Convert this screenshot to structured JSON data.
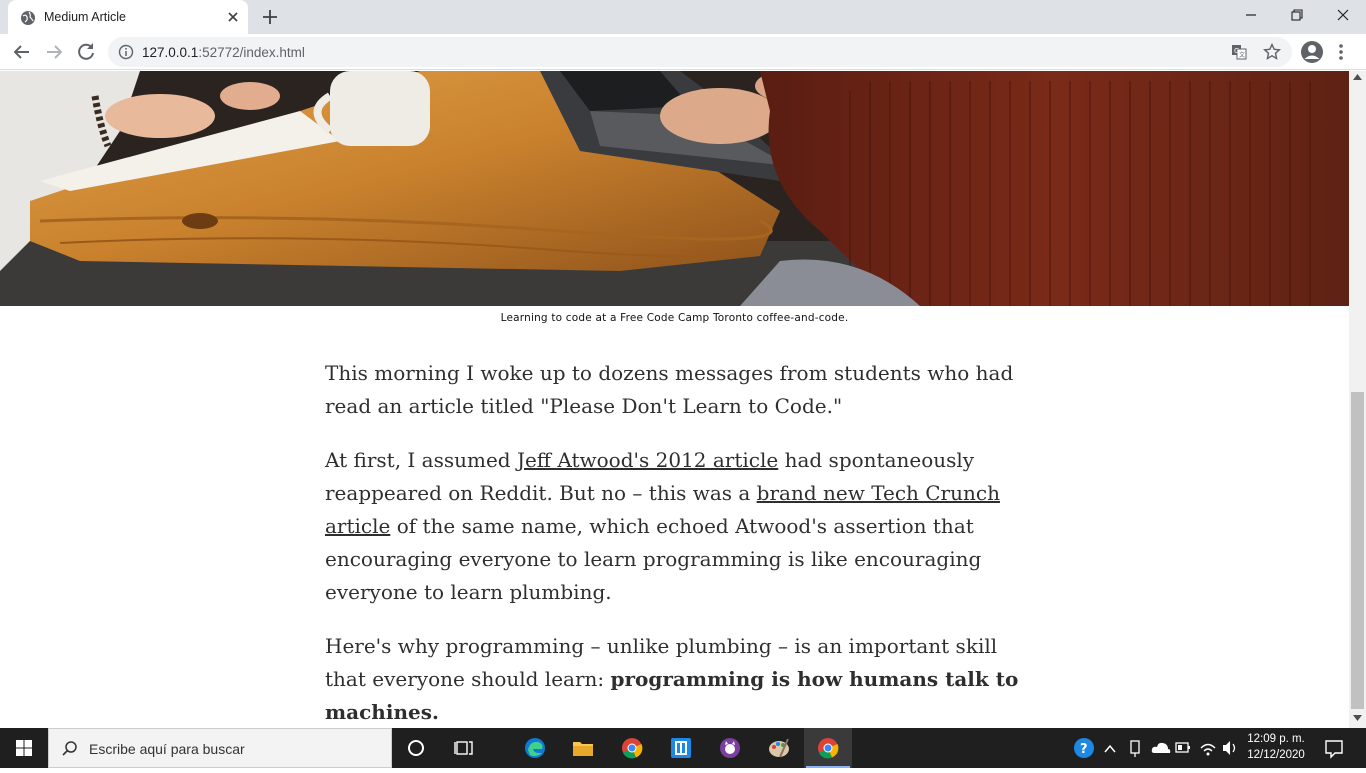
{
  "browser": {
    "tab_title": "Medium Article",
    "url_host": "127.0.0.1",
    "url_path": ":52772/index.html"
  },
  "article": {
    "caption": "Learning to code at a Free Code Camp Toronto coffee-and-code.",
    "p1": "This morning I woke up to dozens messages from students who had read an article titled \"Please Don't Learn to Code.\"",
    "p2_a": "At first, I assumed ",
    "p2_link1": "Jeff Atwood's 2012 article",
    "p2_b": " had spontaneously reappeared on Reddit. But no – this was a ",
    "p2_link2": "brand new Tech Crunch article",
    "p2_c": " of the same name, which echoed Atwood's assertion that encouraging everyone to learn programming is like encouraging everyone to learn plumbing.",
    "p3_a": "Here's why programming – unlike plumbing – is an important skill that everyone should learn: ",
    "p3_bold": "programming is how humans talk to machines."
  },
  "taskbar": {
    "search_placeholder": "Escribe aquí para buscar",
    "time": "12:09 p. m.",
    "date": "12/12/2020"
  },
  "colors": {
    "accent_blue": "#8ab4f8",
    "chrome_bg": "#dee1e6"
  }
}
